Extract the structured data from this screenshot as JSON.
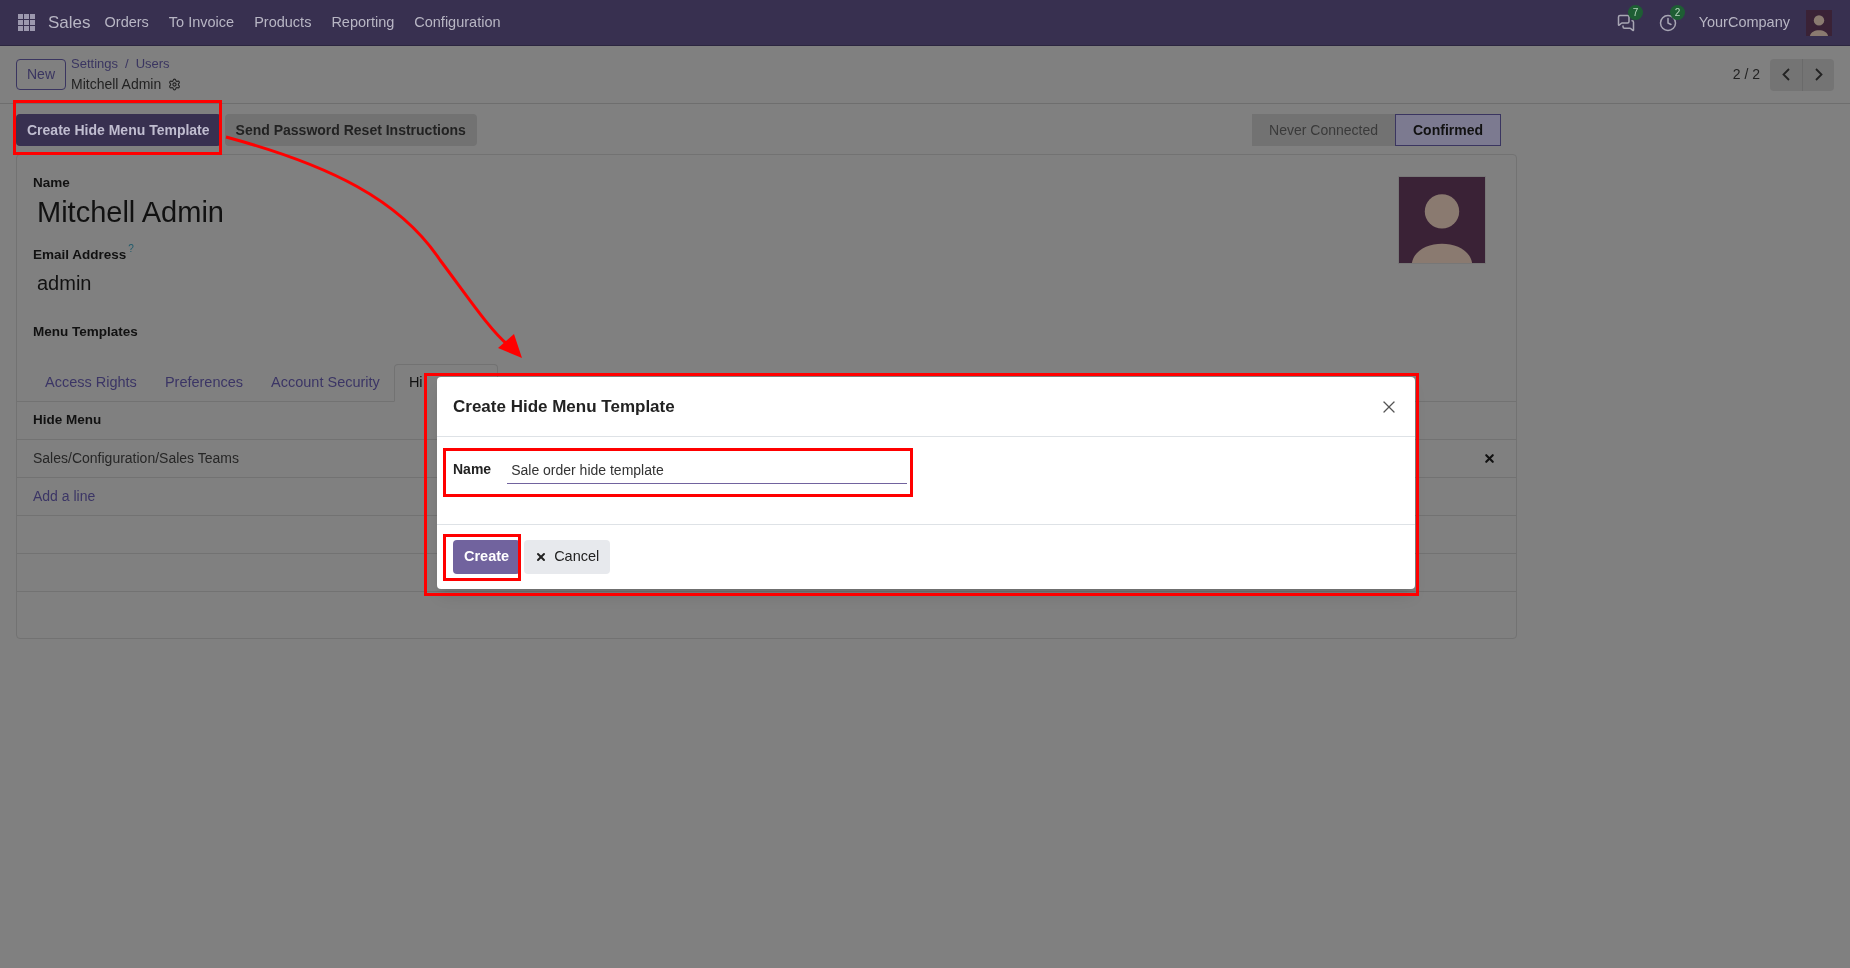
{
  "navbar": {
    "app": "Sales",
    "menu": [
      "Orders",
      "To Invoice",
      "Products",
      "Reporting",
      "Configuration"
    ],
    "messages_count": "7",
    "activities_count": "2",
    "company": "YourCompany"
  },
  "control_panel": {
    "new_button": "New",
    "breadcrumbs": [
      "Settings",
      "Users"
    ],
    "breadcrumb_separator": "/",
    "record": "Mitchell Admin",
    "pager": "2 / 2"
  },
  "actions": [
    "Create Hide Menu Template",
    "Send Password Reset Instructions"
  ],
  "statusbar": [
    {
      "label": "Never Connected",
      "selected": false
    },
    {
      "label": "Confirmed",
      "selected": true
    }
  ],
  "form": {
    "name_label": "Name",
    "name": "Mitchell Admin",
    "email_label": "Email Address",
    "email_help": "?",
    "email": "admin",
    "menu_templates_label": "Menu Templates",
    "tabs": [
      {
        "label": "Access Rights",
        "selected": false
      },
      {
        "label": "Preferences",
        "selected": false
      },
      {
        "label": "Account Security",
        "selected": false
      },
      {
        "label": "Hi",
        "selected": true
      }
    ],
    "list": {
      "column": "Hide Menu",
      "rows": [
        "Sales/Configuration/Sales Teams"
      ],
      "add_line": "Add a line"
    }
  },
  "dialog": {
    "title": "Create Hide Menu Template",
    "field_label": "Name",
    "field_value": "Sale order hide template",
    "buttons": [
      {
        "label": "Create",
        "kind": "primary"
      },
      {
        "label": "Cancel",
        "kind": "secondary"
      }
    ]
  }
}
